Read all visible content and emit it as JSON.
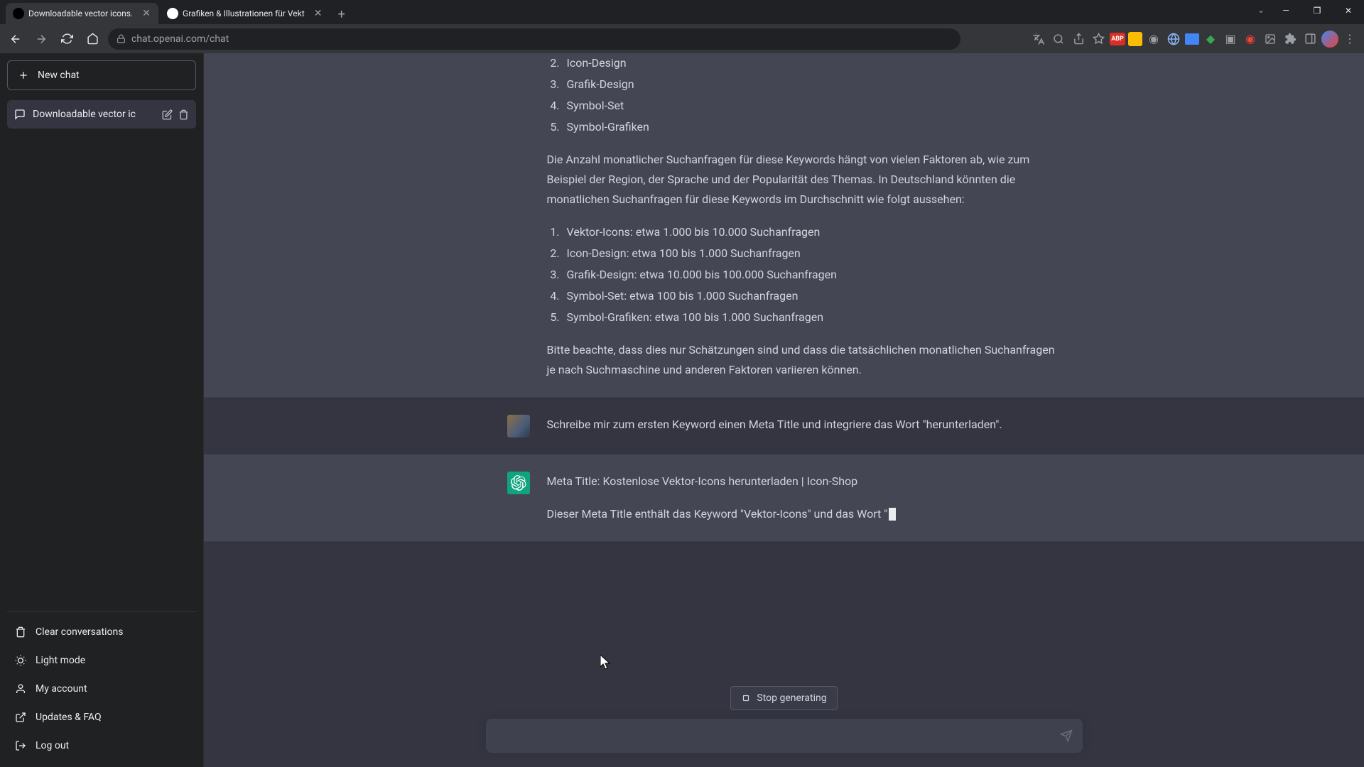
{
  "browser": {
    "tabs": [
      {
        "label": "Downloadable vector icons."
      },
      {
        "label": "Grafiken & Illustrationen für Vekt"
      }
    ],
    "url": "chat.openai.com/chat"
  },
  "sidebar": {
    "new_chat": "New chat",
    "active_chat": "Downloadable vector ic",
    "links": {
      "clear": "Clear conversations",
      "light": "Light mode",
      "account": "My account",
      "updates": "Updates & FAQ",
      "logout": "Log out"
    }
  },
  "conversation": {
    "assistant1": {
      "list1": {
        "i2": "Icon-Design",
        "i3": "Grafik-Design",
        "i4": "Symbol-Set",
        "i5": "Symbol-Grafiken"
      },
      "para1": "Die Anzahl monatlicher Suchanfragen für diese Keywords hängt von vielen Faktoren ab, wie zum Beispiel der Region, der Sprache und der Popularität des Themas. In Deutschland könnten die monatlichen Suchanfragen für diese Keywords im Durchschnitt wie folgt aussehen:",
      "list2": {
        "i1": "Vektor-Icons: etwa 1.000 bis 10.000 Suchanfragen",
        "i2": "Icon-Design: etwa 100 bis 1.000 Suchanfragen",
        "i3": "Grafik-Design: etwa 10.000 bis 100.000 Suchanfragen",
        "i4": "Symbol-Set: etwa 100 bis 1.000 Suchanfragen",
        "i5": "Symbol-Grafiken: etwa 100 bis 1.000 Suchanfragen"
      },
      "para2": "Bitte beachte, dass dies nur Schätzungen sind und dass die tatsächlichen monatlichen Suchanfragen je nach Suchmaschine und anderen Faktoren variieren können."
    },
    "user1": "Schreibe mir zum ersten Keyword einen Meta Title und integriere das Wort \"herunterladen\".",
    "assistant2": {
      "line1": "Meta Title: Kostenlose Vektor-Icons herunterladen | Icon-Shop",
      "line2": "Dieser Meta Title enthält das Keyword \"Vektor-Icons\" und das Wort \""
    }
  },
  "controls": {
    "stop": "Stop generating",
    "placeholder": ""
  }
}
